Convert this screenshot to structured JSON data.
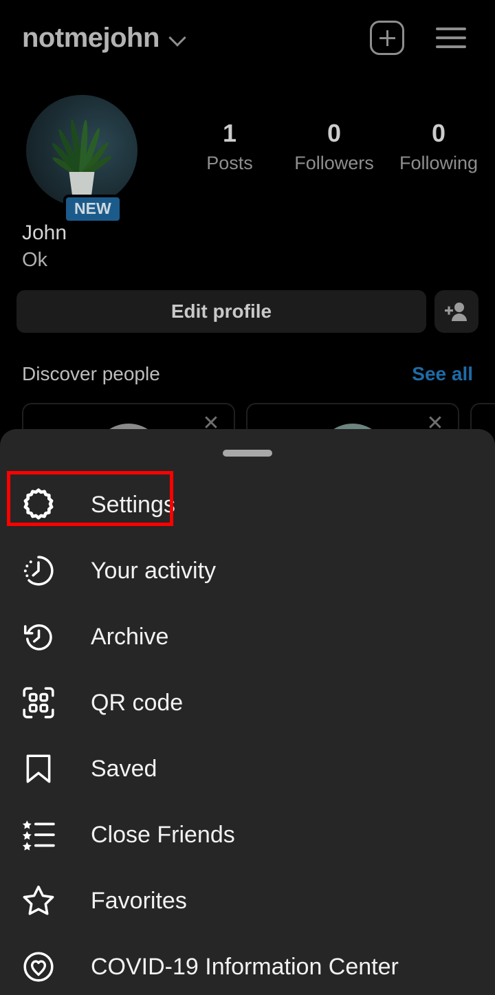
{
  "header": {
    "username": "notmejohn",
    "chevron_icon": "chevron-down-icon",
    "add_icon": "plus-square-icon",
    "menu_icon": "hamburger-menu-icon"
  },
  "profile": {
    "avatar_alt": "potted-plant-photo",
    "new_badge": "NEW",
    "full_name": "John",
    "bio": "Ok",
    "stats": [
      {
        "value": "1",
        "label": "Posts"
      },
      {
        "value": "0",
        "label": "Followers"
      },
      {
        "value": "0",
        "label": "Following"
      }
    ],
    "edit_profile_label": "Edit profile",
    "add_person_icon": "person-add-icon"
  },
  "discover": {
    "title": "Discover people",
    "see_all": "See all",
    "close_icon": "close-icon",
    "cards": [
      {
        "close": "✕"
      },
      {
        "close": "✕"
      }
    ]
  },
  "sheet": {
    "handle": "drag-handle",
    "items": [
      {
        "label": "Settings",
        "icon": "gear-icon",
        "highlighted": true
      },
      {
        "label": "Your activity",
        "icon": "clock-activity-icon",
        "highlighted": false
      },
      {
        "label": "Archive",
        "icon": "history-clock-icon",
        "highlighted": false
      },
      {
        "label": "QR code",
        "icon": "qr-code-icon",
        "highlighted": false
      },
      {
        "label": "Saved",
        "icon": "bookmark-icon",
        "highlighted": false
      },
      {
        "label": "Close Friends",
        "icon": "star-list-icon",
        "highlighted": false
      },
      {
        "label": "Favorites",
        "icon": "star-icon",
        "highlighted": false
      },
      {
        "label": "COVID-19 Information Center",
        "icon": "heart-circle-icon",
        "highlighted": false
      }
    ]
  },
  "annotation": {
    "highlight_color": "#ff0000",
    "target": "Settings"
  },
  "colors": {
    "background": "#000000",
    "sheet_background": "#262626",
    "accent_link": "#1d6ca8",
    "badge_blue": "#1b5b8c",
    "text_primary": "#f2f2f2",
    "text_secondary": "#8e8e8e"
  }
}
